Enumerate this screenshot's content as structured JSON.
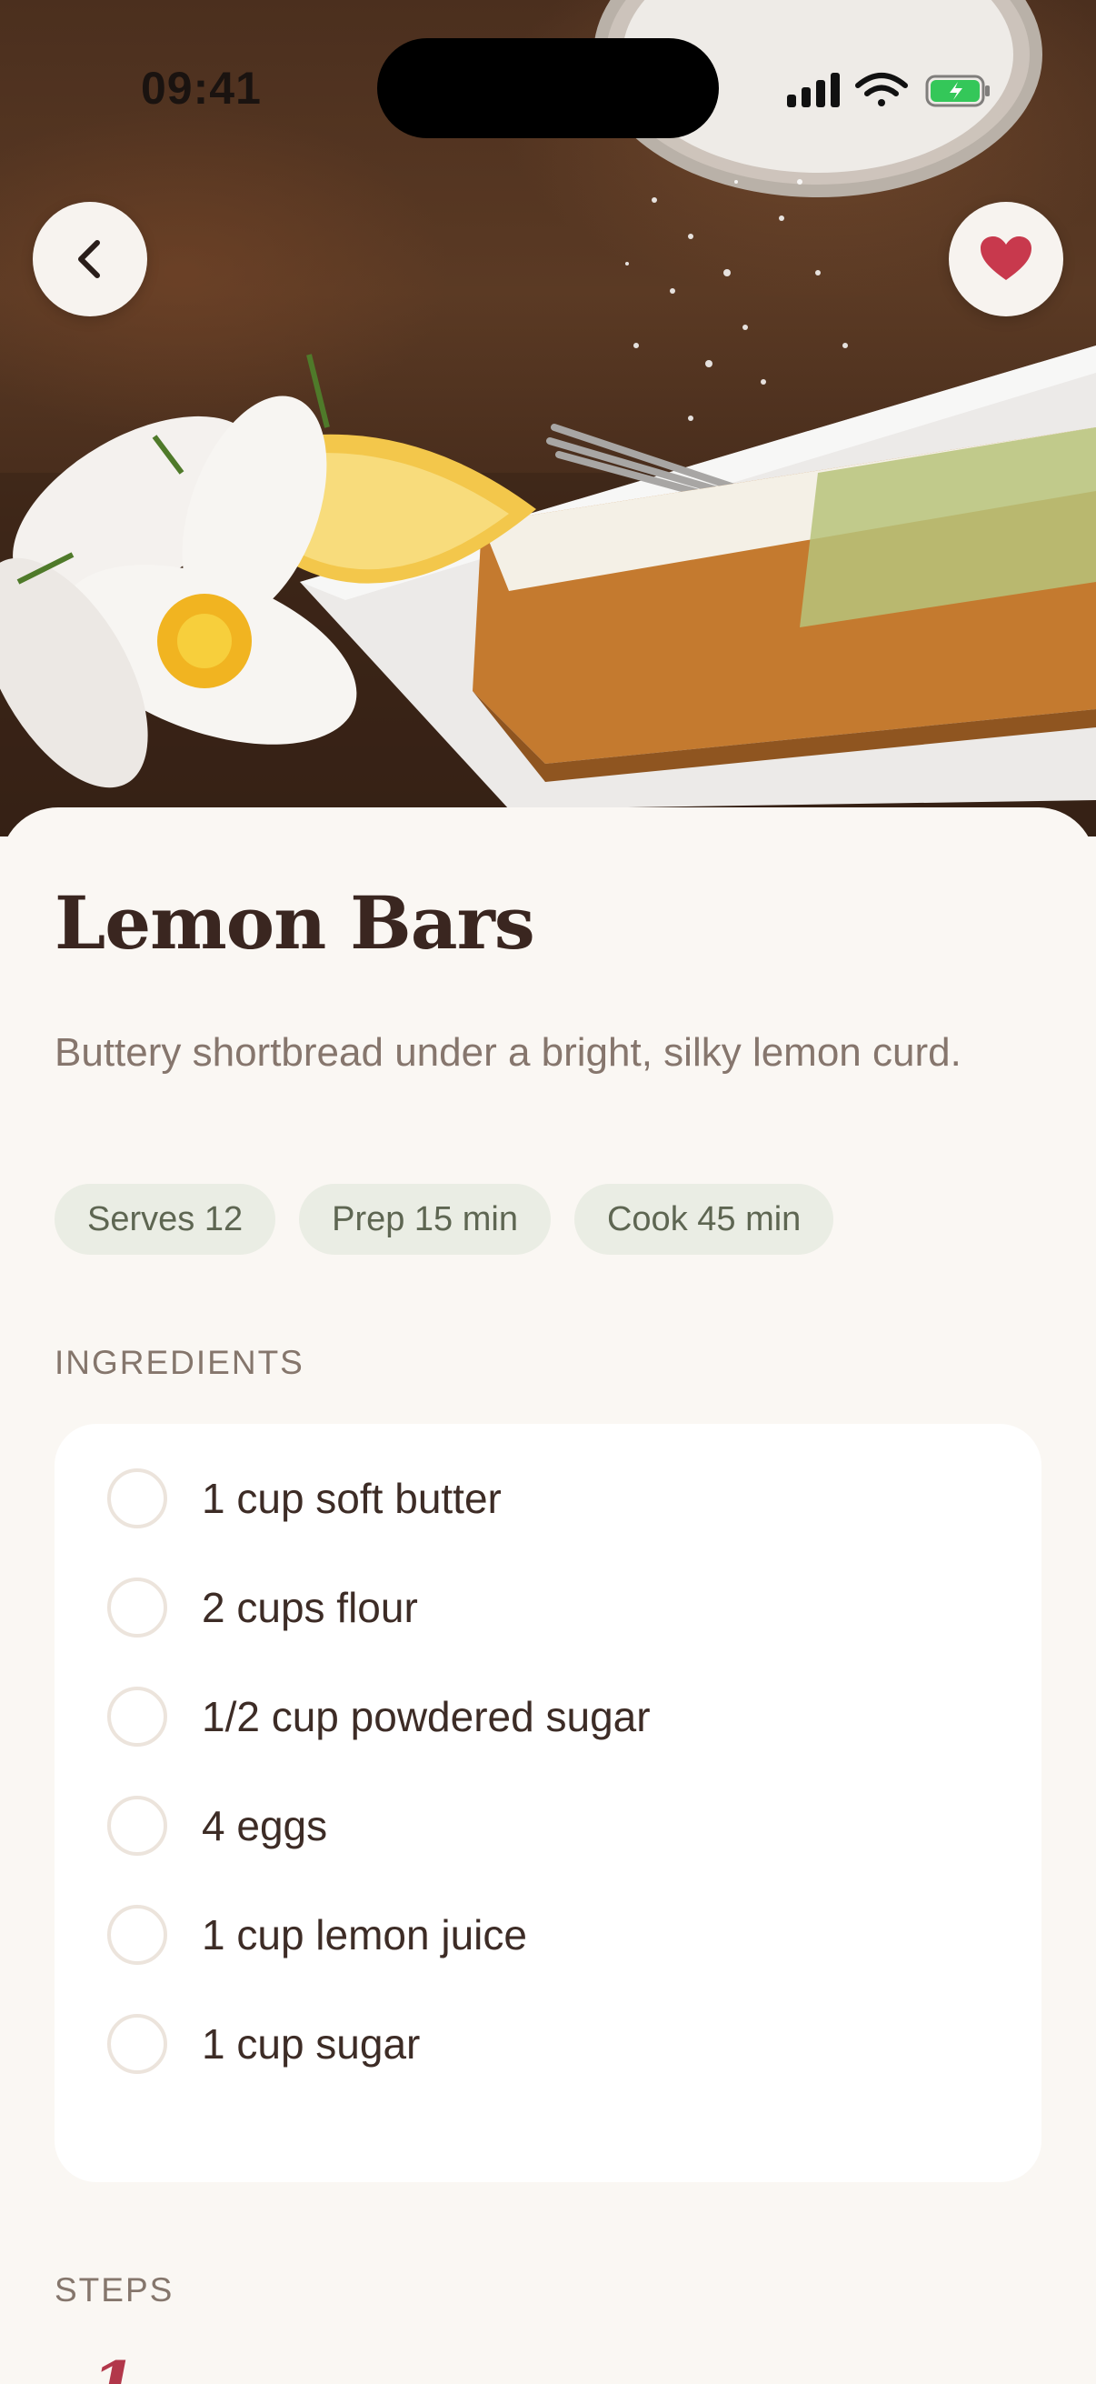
{
  "status_bar": {
    "time": "09:41"
  },
  "hero": {
    "image": "lemon-cake-photo"
  },
  "buttons": {
    "back_icon": "chevron-left-icon",
    "favorite_icon": "heart-icon",
    "favorite_color": "#c8394d"
  },
  "recipe": {
    "title": "Lemon Bars",
    "subtitle": "Buttery shortbread under a bright, silky lemon curd.",
    "chips": [
      "Serves 12",
      "Prep 15 min",
      "Cook 45 min"
    ]
  },
  "ingredients": {
    "label": "INGREDIENTS",
    "items": [
      "1 cup soft butter",
      "2 cups flour",
      "1/2 cup powdered sugar",
      "4 eggs",
      "1 cup lemon juice",
      "1 cup sugar"
    ]
  },
  "steps": {
    "label": "STEPS",
    "first_number": "1"
  }
}
